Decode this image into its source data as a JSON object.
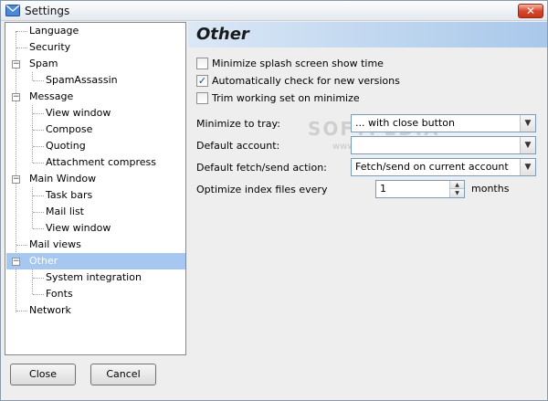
{
  "window": {
    "title": "Settings"
  },
  "tree": {
    "items": [
      {
        "label": "Language"
      },
      {
        "label": "Security"
      },
      {
        "label": "Spam"
      },
      {
        "label": "SpamAssassin"
      },
      {
        "label": "Message"
      },
      {
        "label": "View window"
      },
      {
        "label": "Compose"
      },
      {
        "label": "Quoting"
      },
      {
        "label": "Attachment compress"
      },
      {
        "label": "Main Window"
      },
      {
        "label": "Task bars"
      },
      {
        "label": "Mail list"
      },
      {
        "label": "View window"
      },
      {
        "label": "Mail views"
      },
      {
        "label": "Other"
      },
      {
        "label": "System integration"
      },
      {
        "label": "Fonts"
      },
      {
        "label": "Network"
      }
    ],
    "selected": "Other"
  },
  "panel": {
    "title": "Other",
    "checkboxes": [
      {
        "label": "Minimize splash screen show time",
        "checked": false
      },
      {
        "label": "Automatically check for new versions",
        "checked": true
      },
      {
        "label": "Trim working set on minimize",
        "checked": false
      }
    ],
    "minimize_to_tray": {
      "label": "Minimize to tray:",
      "value": "... with close button"
    },
    "default_account": {
      "label": "Default account:",
      "value": ""
    },
    "default_fetch": {
      "label": "Default fetch/send action:",
      "value": "Fetch/send on current account"
    },
    "optimize": {
      "label": "Optimize index files every",
      "value": "1",
      "unit": "months"
    }
  },
  "watermark": {
    "text": "SOFTPEDIA",
    "url": "www.softpedia.com"
  },
  "buttons": {
    "close": "Close",
    "cancel": "Cancel"
  },
  "glyphs": {
    "check": "✓",
    "arrow_down": "▼",
    "spin_up": "▲",
    "spin_down": "▼",
    "minus": "−",
    "close_x": "✕"
  }
}
